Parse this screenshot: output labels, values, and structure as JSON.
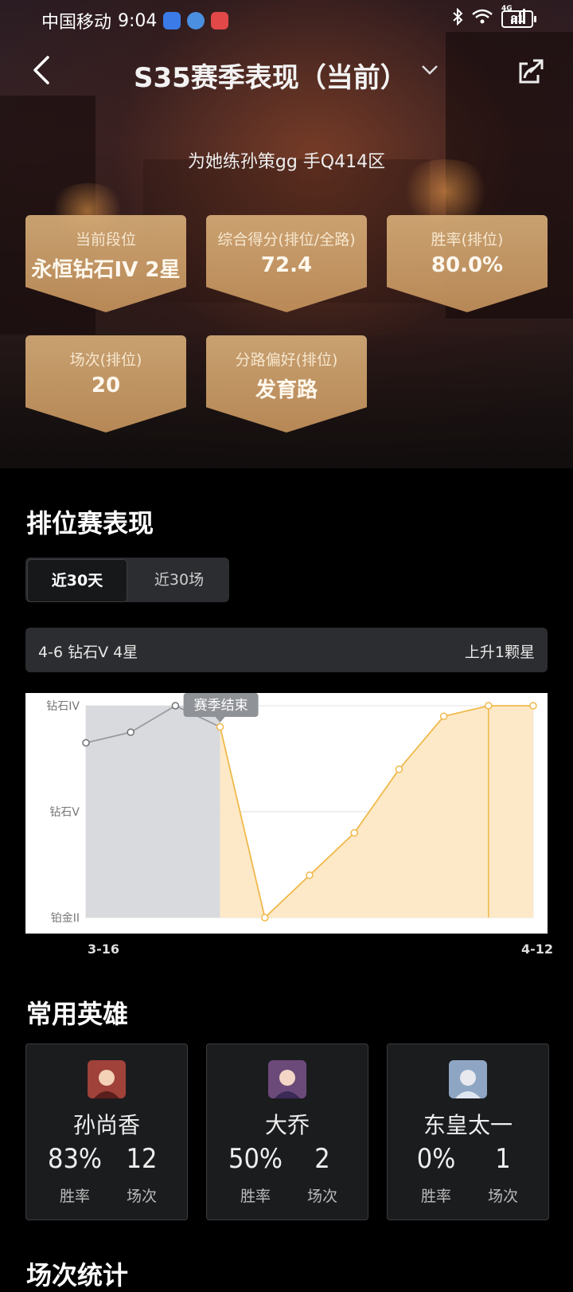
{
  "status_bar": {
    "carrier": "中国移动",
    "time": "9:04",
    "network": "4G",
    "battery": "91"
  },
  "nav": {
    "title": "S35赛季表现（当前）"
  },
  "profile": {
    "subtitle": "为她练孙策gg  手Q414区"
  },
  "stats": [
    {
      "label": "当前段位",
      "value": "永恒钻石IV 2星"
    },
    {
      "label": "综合得分(排位/全路)",
      "value": "72.4"
    },
    {
      "label": "胜率(排位)",
      "value": "80.0%"
    },
    {
      "label": "场次(排位)",
      "value": "20"
    },
    {
      "label": "分路偏好(排位)",
      "value": "发育路"
    }
  ],
  "ranked": {
    "heading": "排位赛表现",
    "tabs": [
      "近30天",
      "近30场"
    ],
    "active_tab": "近30天",
    "info_left": "4-6 钻石V 4星",
    "info_right": "上升1颗星"
  },
  "chart_data": {
    "type": "line",
    "y_ticks": [
      "钻石IV",
      "钻石V",
      "铂金II"
    ],
    "x_start": "3-16",
    "x_end": "4-12",
    "tooltip": "赛季结束",
    "colors": {
      "past": "#9a9ca0",
      "current": "#f0b94a",
      "past_fill": "#d8dadd",
      "current_fill": "#fde9c8"
    },
    "series": [
      {
        "segment": "past",
        "values": [
          0.65,
          0.75,
          1.0,
          0.8
        ]
      },
      {
        "segment": "current",
        "values": [
          0.8,
          -1.0,
          -0.6,
          -0.2,
          0.4,
          0.9,
          1.1,
          1.7
        ]
      }
    ]
  },
  "heroes": {
    "heading": "常用英雄",
    "items": [
      {
        "name": "孙尚香",
        "winrate": "83%",
        "games": "12",
        "winrate_label": "胜率",
        "games_label": "场次",
        "avatar_color": "#a0413a"
      },
      {
        "name": "大乔",
        "winrate": "50%",
        "games": "2",
        "winrate_label": "胜率",
        "games_label": "场次",
        "avatar_color": "#6b4a7a"
      },
      {
        "name": "东皇太一",
        "winrate": "0%",
        "games": "1",
        "winrate_label": "胜率",
        "games_label": "场次",
        "avatar_color": "#8ea6c4"
      }
    ]
  },
  "next_section": {
    "heading": "场次统计"
  }
}
